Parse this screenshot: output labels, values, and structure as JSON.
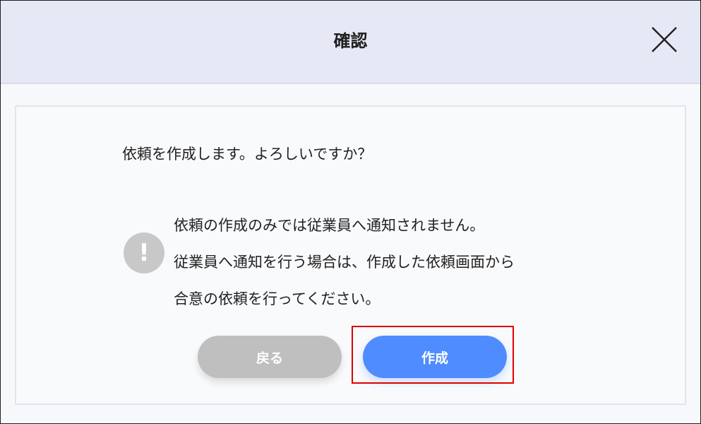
{
  "dialog": {
    "title": "確認",
    "close_icon": "close-icon",
    "question": "依頼を作成します。よろしいですか？",
    "notice": {
      "icon": "exclamation-icon",
      "lines": [
        "依頼の作成のみでは従業員へ通知されません。",
        "従業員へ通知を行う場合は、作成した依頼画面から",
        "合意の依頼を行ってください。"
      ]
    },
    "buttons": {
      "back_label": "戻る",
      "create_label": "作成"
    }
  },
  "colors": {
    "header_bg": "#e6e8f5",
    "back_button": "#bfbfbf",
    "create_button": "#4f8cff",
    "highlight_border": "#e00000",
    "notice_icon": "#c8c8c8"
  }
}
